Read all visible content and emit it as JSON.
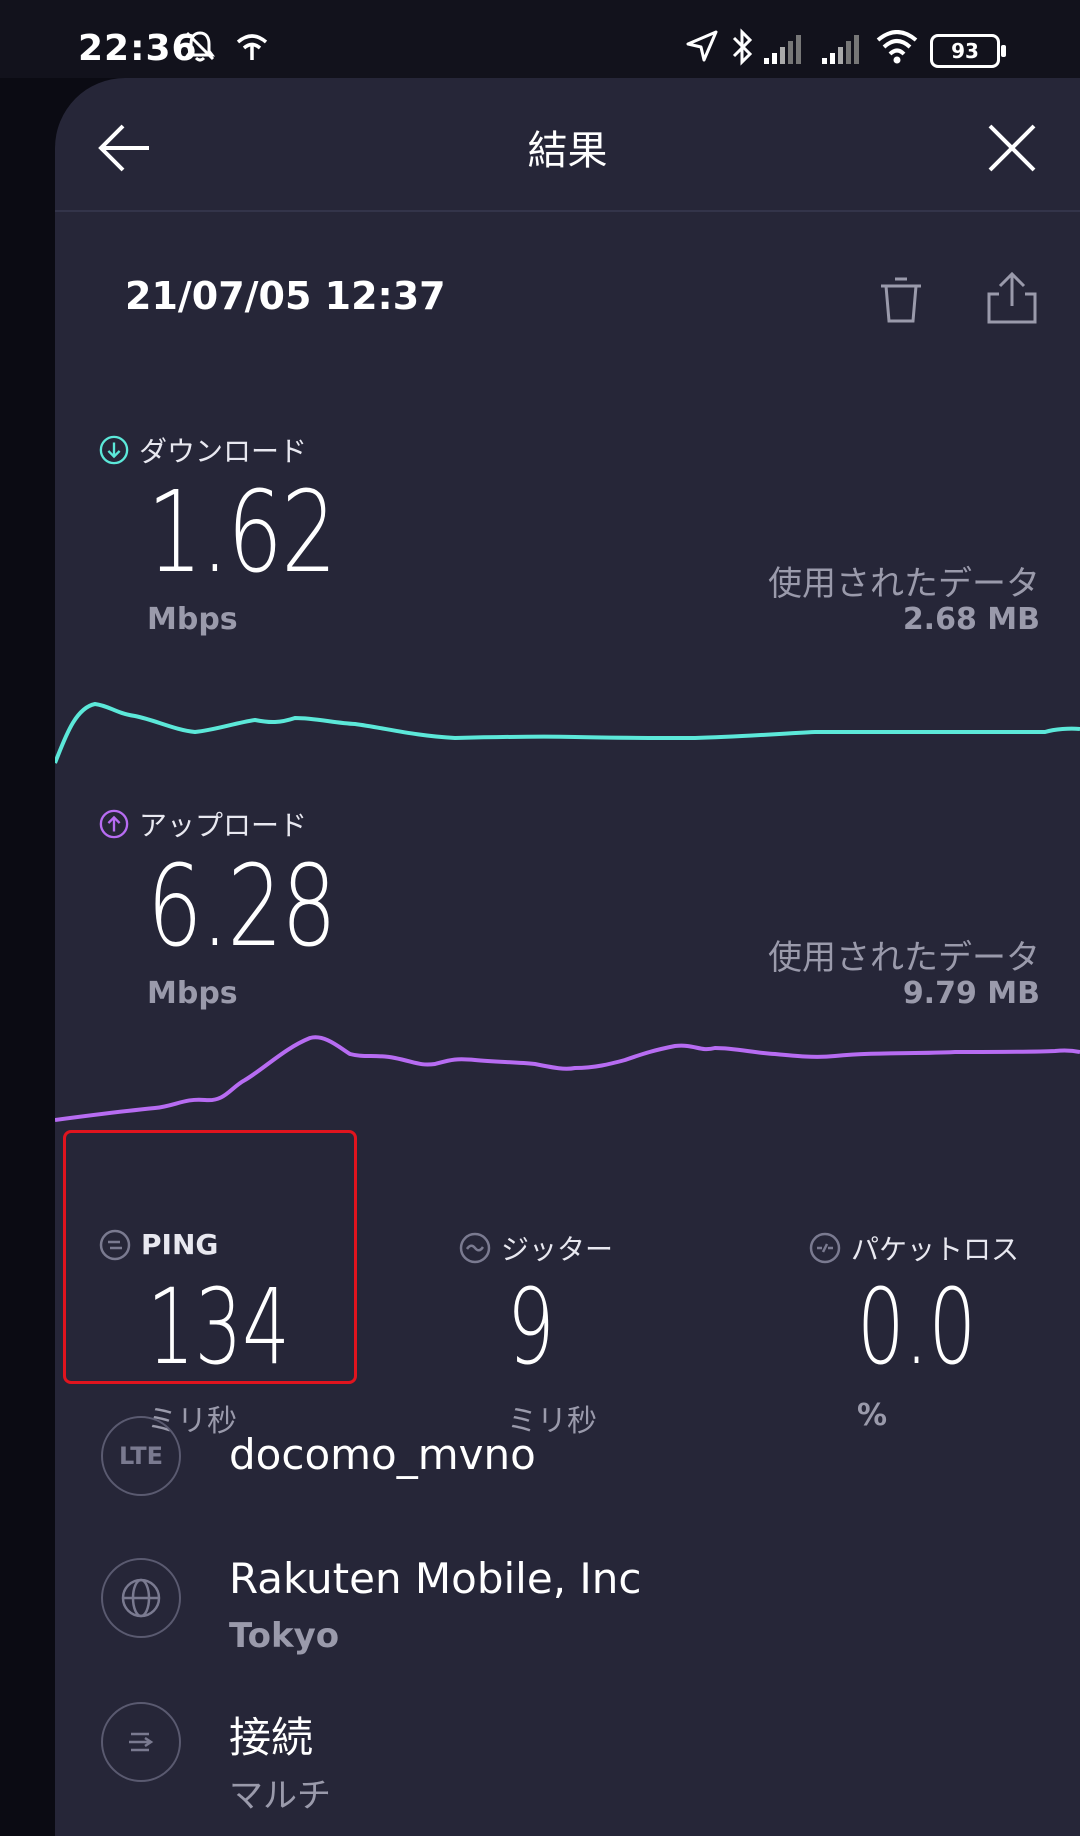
{
  "status_bar": {
    "time": "22:36",
    "battery": "93",
    "icons": [
      "mute-bell-icon",
      "wifi-arrow-icon",
      "location-arrow-icon",
      "bluetooth-icon",
      "signal-icon",
      "signal-icon",
      "wifi-icon",
      "battery-icon"
    ]
  },
  "header": {
    "title": "結果",
    "back_icon": "back-arrow-icon",
    "close_icon": "close-icon"
  },
  "result": {
    "datetime": "21/07/05 12:37",
    "trash_icon": "trash-icon",
    "share_icon": "share-icon"
  },
  "download": {
    "label": "ダウンロード",
    "value": "1.62",
    "unit": "Mbps",
    "used_label": "使用されたデータ",
    "used_value": "2.68 MB",
    "color": "#5ce8d9"
  },
  "upload": {
    "label": "アップロード",
    "value": "6.28",
    "unit": "Mbps",
    "used_label": "使用されたデータ",
    "used_value": "9.79 MB",
    "color": "#b76cf2"
  },
  "ping": {
    "label": "PING",
    "value": "134",
    "unit": "ミリ秒"
  },
  "jitter": {
    "label": "ジッター",
    "value": "9",
    "unit": "ミリ秒"
  },
  "packet_loss": {
    "label": "パケットロス",
    "value": "0.0",
    "unit": "%"
  },
  "network": {
    "icon_text": "LTE",
    "name": "docomo_mvno"
  },
  "server": {
    "name": "Rakuten Mobile, Inc",
    "location": "Tokyo"
  },
  "connection": {
    "label": "接続",
    "value": "マルチ"
  }
}
